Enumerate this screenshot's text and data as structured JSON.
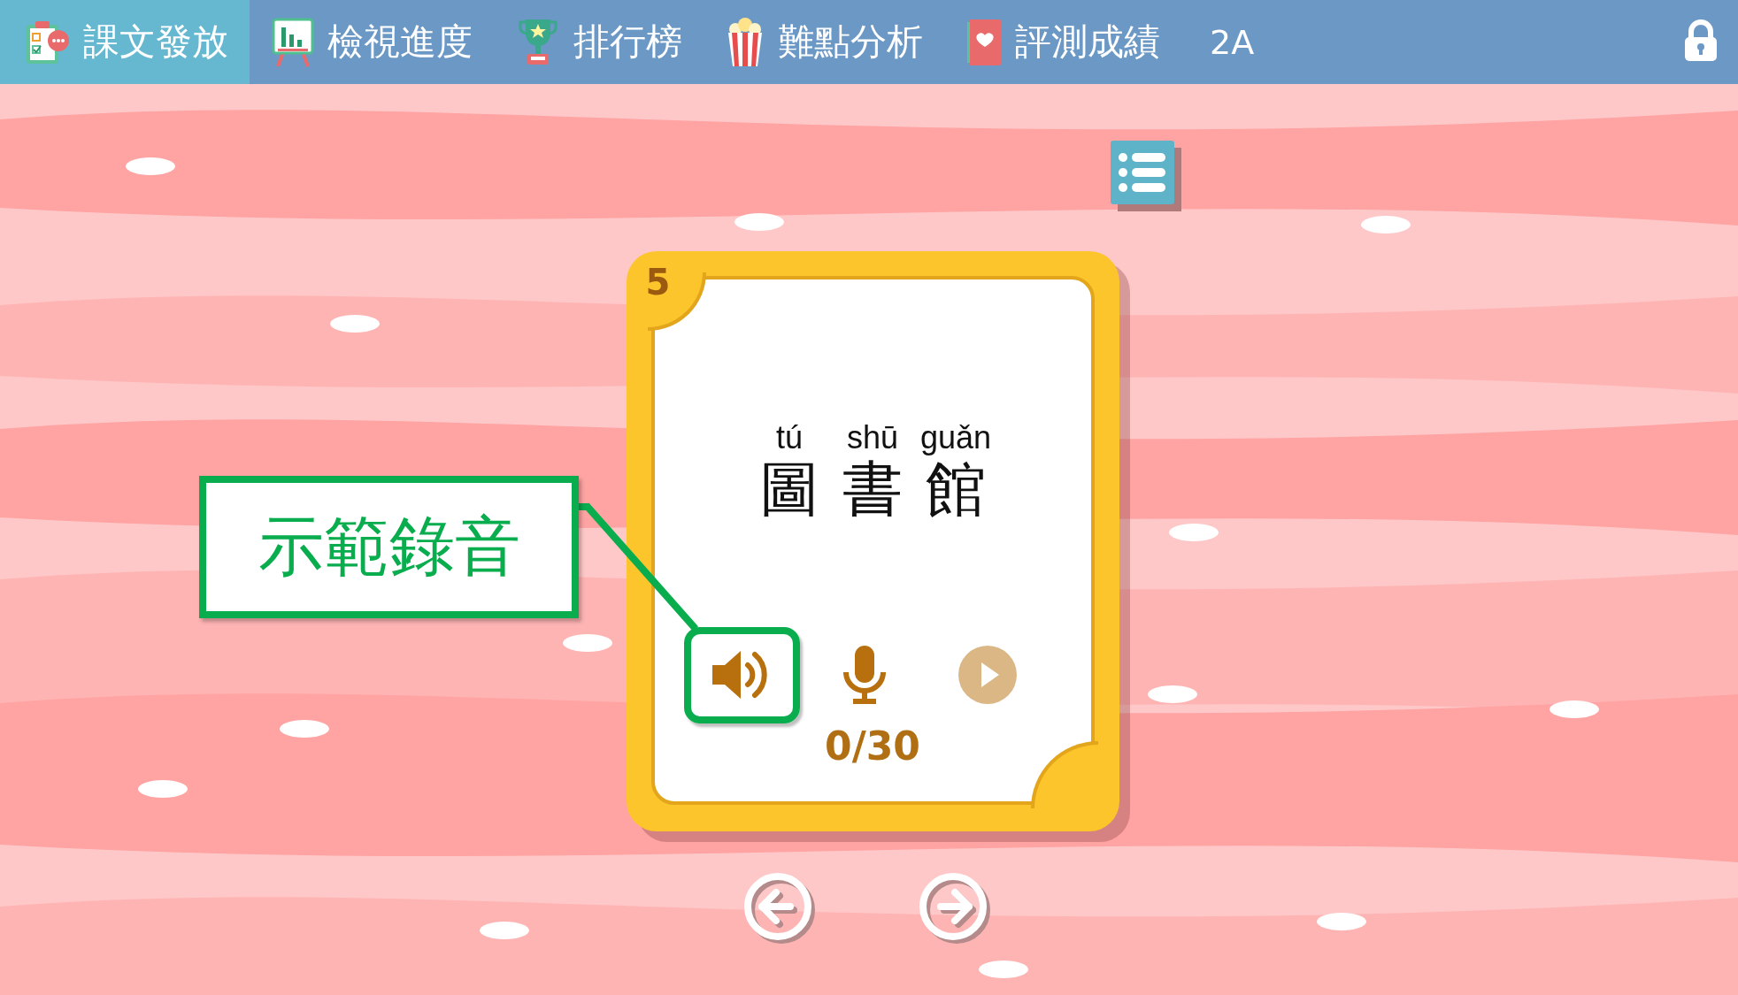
{
  "tabs": [
    {
      "label": "課文發放",
      "selected": true
    },
    {
      "label": "檢視進度",
      "selected": false
    },
    {
      "label": "排行榜",
      "selected": false
    },
    {
      "label": "難點分析",
      "selected": false
    },
    {
      "label": "評測成績",
      "selected": false
    }
  ],
  "class_label": "2A",
  "card": {
    "number": "5",
    "syllables": [
      {
        "pinyin": "tú",
        "character": "圖"
      },
      {
        "pinyin": "shū",
        "character": "書"
      },
      {
        "pinyin": "guǎn",
        "character": "館"
      }
    ],
    "controls": [
      {
        "kind": "speaker",
        "highlighted": true,
        "disabled": false
      },
      {
        "kind": "mic",
        "highlighted": false,
        "disabled": false
      },
      {
        "kind": "play",
        "highlighted": false,
        "disabled": true
      }
    ],
    "count": "0/30"
  },
  "callout": {
    "text": "示範錄音"
  }
}
